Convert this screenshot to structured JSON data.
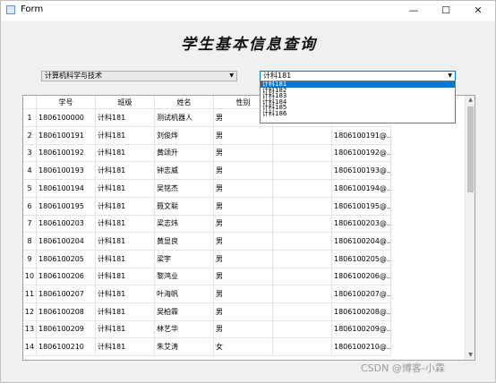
{
  "window": {
    "title": "Form",
    "minimize": "—",
    "maximize": "☐",
    "close": "✕"
  },
  "heading": "学生基本信息查询",
  "major_combo": {
    "value": "计算机科学与技术"
  },
  "class_combo": {
    "value": "计科181",
    "options": [
      "计科181",
      "计科182",
      "计科183",
      "计科184",
      "计科185",
      "计科186"
    ],
    "selected_index": 0
  },
  "table": {
    "headers": [
      "学号",
      "班级",
      "姓名",
      "性别",
      "",
      ""
    ],
    "rows": [
      [
        "1806100000",
        "计科181",
        "测试机器人",
        "男",
        "",
        ""
      ],
      [
        "1806100191",
        "计科181",
        "刘俊烨",
        "男",
        "",
        "1806100191@..."
      ],
      [
        "1806100192",
        "计科181",
        "黄颂升",
        "男",
        "",
        "1806100192@..."
      ],
      [
        "1806100193",
        "计科181",
        "钟志威",
        "男",
        "",
        "1806100193@..."
      ],
      [
        "1806100194",
        "计科181",
        "吴铭杰",
        "男",
        "",
        "1806100194@..."
      ],
      [
        "1806100195",
        "计科181",
        "聂文聪",
        "男",
        "",
        "1806100195@..."
      ],
      [
        "1806100203",
        "计科181",
        "梁志炜",
        "男",
        "",
        "1806100203@..."
      ],
      [
        "1806100204",
        "计科181",
        "黄显良",
        "男",
        "",
        "1806100204@..."
      ],
      [
        "1806100205",
        "计科181",
        "梁宇",
        "男",
        "",
        "1806100205@..."
      ],
      [
        "1806100206",
        "计科181",
        "黎鸿业",
        "男",
        "",
        "1806100206@..."
      ],
      [
        "1806100207",
        "计科181",
        "叶海帆",
        "男",
        "",
        "1806100207@..."
      ],
      [
        "1806100208",
        "计科181",
        "吴柏霖",
        "男",
        "",
        "1806100208@..."
      ],
      [
        "1806100209",
        "计科181",
        "林艺华",
        "男",
        "",
        "1806100209@..."
      ],
      [
        "1806100210",
        "计科181",
        "朱艾涛",
        "女",
        "",
        "1806100210@..."
      ]
    ],
    "row_numbers": [
      "1",
      "2",
      "3",
      "4",
      "5",
      "6",
      "7",
      "8",
      "9",
      "10",
      "11",
      "12",
      "13",
      "14"
    ]
  },
  "watermark": "CSDN @博客-小霖"
}
